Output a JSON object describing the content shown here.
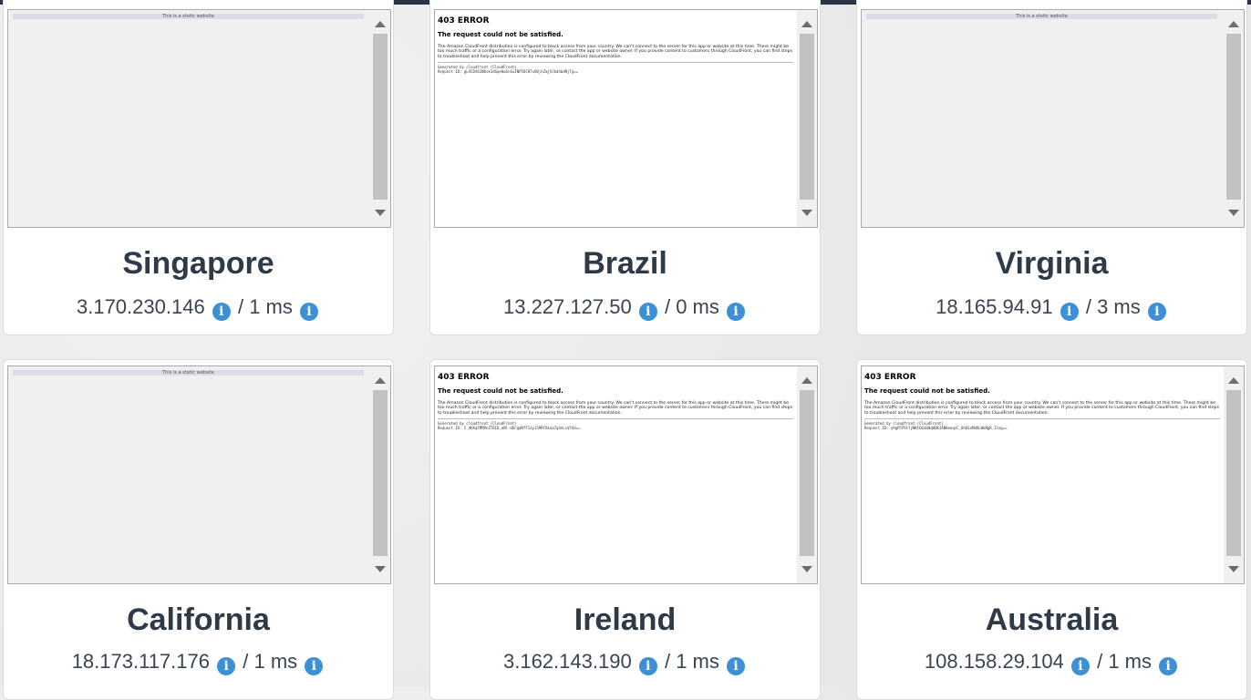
{
  "static_text": "This is a static website",
  "error_page": {
    "title": "403 ERROR",
    "heading": "The request could not be satisfied.",
    "body": "The Amazon CloudFront distribution is configured to block access from your country. We can't connect to the server for this app or website at this time. There might be too much traffic or a configuration error. Try again later, or contact the app or website owner. If you provide content to customers through CloudFront, you can find steps to troubleshoot and help prevent this error by reviewing the CloudFront documentation.",
    "generated_by": "Generated by cloudfront (CloudFront)"
  },
  "separator": "/",
  "info_icon": "info-circle-icon",
  "colors": {
    "accent": "#3d8fd6",
    "heading": "#2f3a48",
    "topbar": "#2b3442"
  },
  "cards": [
    {
      "location": "Singapore",
      "ip": "3.170.230.146",
      "ping": "1 ms",
      "preview": "static"
    },
    {
      "location": "Brazil",
      "ip": "13.227.127.50",
      "ping": "0 ms",
      "preview": "error",
      "request_id": "Request ID: gLVCDX61NKsk3dGqeHwSnSuINP5OCHTuVBjnZmjVJbdhbdNjTg=="
    },
    {
      "location": "Virginia",
      "ip": "18.165.94.91",
      "ping": "3 ms",
      "preview": "static"
    },
    {
      "location": "California",
      "ip": "18.173.117.176",
      "ping": "1 ms",
      "preview": "static"
    },
    {
      "location": "Ireland",
      "ip": "3.162.143.190",
      "ping": "1 ms",
      "preview": "error",
      "request_id": "Request ID: C_dHXqFMMVnZTRID_aNl-UEFgdRfF1zyi59RfXkaa7q4nLsVtXd=="
    },
    {
      "location": "Australia",
      "ip": "108.158.29.104",
      "ping": "1 ms",
      "preview": "error",
      "request_id": "Request ID: yHgPCPSt7yNKtDGzB0qWQK1AN8eeqzC_6h6SxMdOLWkNgR_Ilng=="
    }
  ]
}
